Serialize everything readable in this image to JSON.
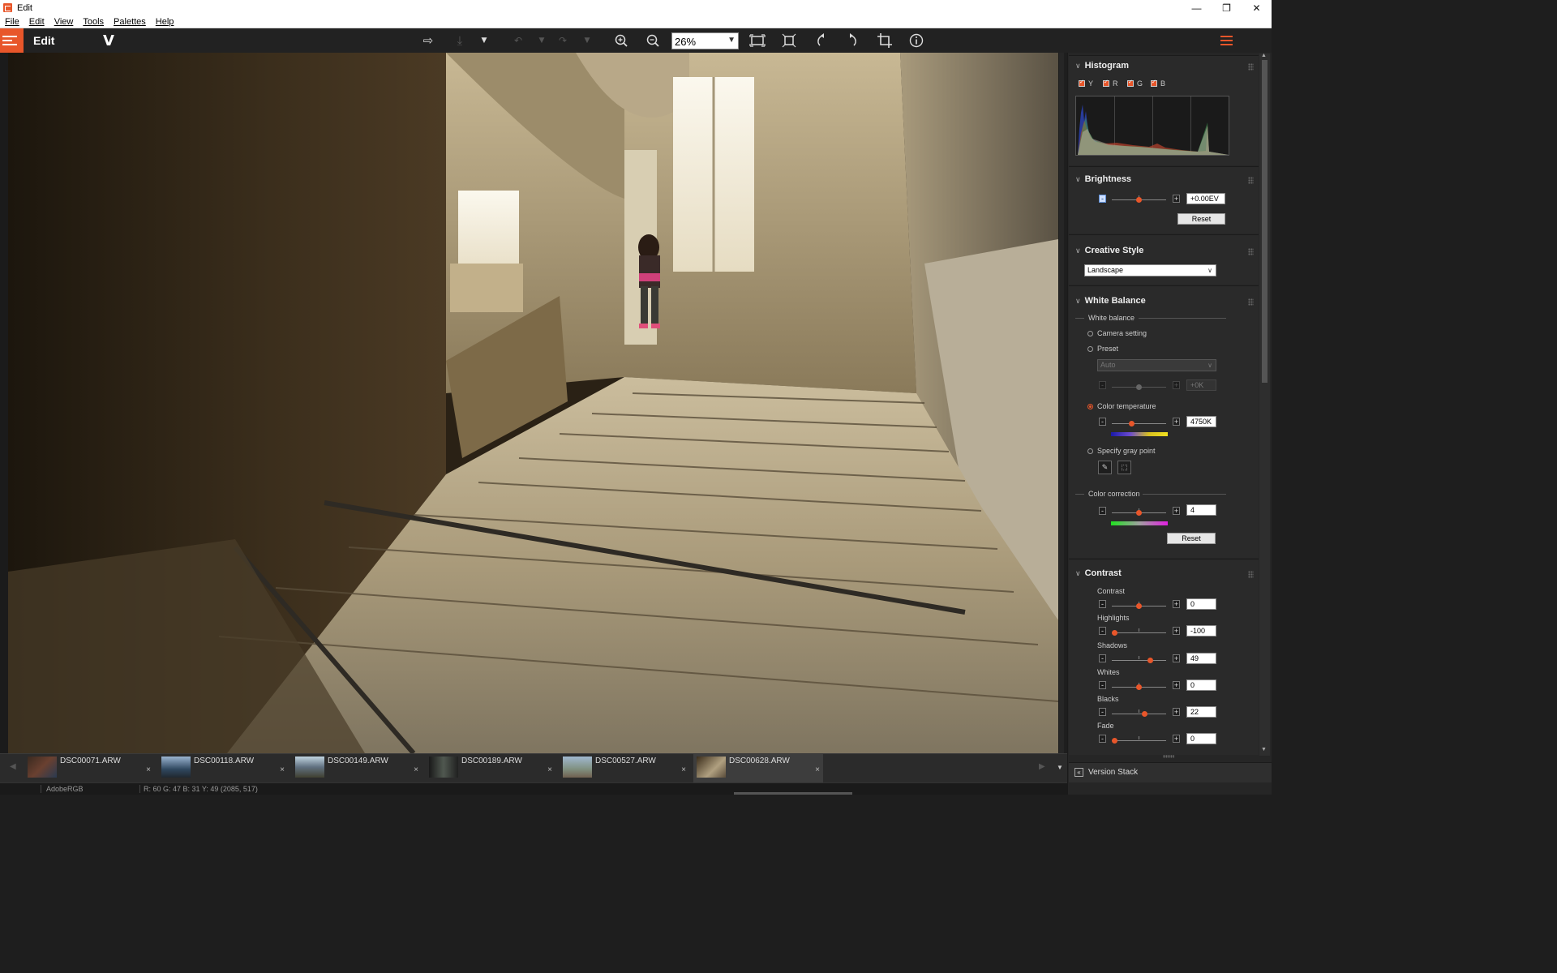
{
  "window": {
    "title": "Edit",
    "controls": [
      "—",
      "❐",
      "✕"
    ]
  },
  "menu": [
    "File",
    "Edit",
    "View",
    "Tools",
    "Palettes",
    "Help"
  ],
  "toolbar": {
    "mode": "Edit",
    "logo": "V",
    "zoom_value": "26%",
    "icons": [
      "export-icon",
      "save-icon",
      "undo-icon",
      "redo-icon",
      "zoom-in-icon",
      "zoom-out-icon",
      "fit-icon",
      "actual-size-icon",
      "rotate-left-icon",
      "rotate-right-icon",
      "crop-icon",
      "info-icon",
      "settings-icon"
    ]
  },
  "panels": {
    "histogram": {
      "title": "Histogram",
      "channels": [
        "Y",
        "R",
        "G",
        "B"
      ]
    },
    "brightness": {
      "title": "Brightness",
      "value": "+0.00EV",
      "level": 0.5,
      "reset": "Reset"
    },
    "creative_style": {
      "title": "Creative Style",
      "selected": "Landscape"
    },
    "white_balance": {
      "title": "White Balance",
      "group_label": "White balance",
      "options": {
        "camera": "Camera setting",
        "preset": "Preset",
        "color_temp": "Color temperature",
        "gray_point": "Specify gray point"
      },
      "preset_selected": "Auto",
      "preset_value": "+0K",
      "preset_level": 0.5,
      "temperature_value": "4750K",
      "temperature_level": 0.35,
      "color_correction_label": "Color correction",
      "color_correction_value": "4",
      "color_correction_level": 0.5,
      "reset": "Reset"
    },
    "contrast": {
      "title": "Contrast",
      "sliders": [
        {
          "label": "Contrast",
          "value": "0",
          "level": 0.5
        },
        {
          "label": "Highlights",
          "value": "-100",
          "level": 0.0
        },
        {
          "label": "Shadows",
          "value": "49",
          "level": 0.73
        },
        {
          "label": "Whites",
          "value": "0",
          "level": 0.5
        },
        {
          "label": "Blacks",
          "value": "22",
          "level": 0.61
        },
        {
          "label": "Fade",
          "value": "0",
          "level": 0.0
        }
      ]
    },
    "version_stack": "Version Stack"
  },
  "filmstrip": [
    {
      "name": "DSC00071.ARW",
      "active": false
    },
    {
      "name": "DSC00118.ARW",
      "active": false
    },
    {
      "name": "DSC00149.ARW",
      "active": false
    },
    {
      "name": "DSC00189.ARW",
      "active": false
    },
    {
      "name": "DSC00527.ARW",
      "active": false
    },
    {
      "name": "DSC00628.ARW",
      "active": true
    }
  ],
  "status": {
    "colorspace": "AdobeRGB",
    "pixel_info": "R: 60  G: 47  B: 31  Y: 49    (2085, 517)"
  }
}
